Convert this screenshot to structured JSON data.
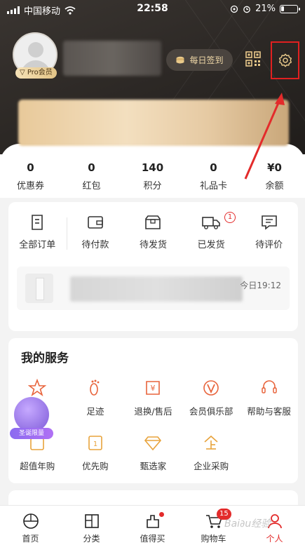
{
  "status_bar": {
    "carrier": "中国移动",
    "time": "22:58",
    "battery": "21%",
    "battery_level": 0.21
  },
  "profile": {
    "badge": "Pro会员",
    "checkin_label": "每日签到"
  },
  "assets": [
    {
      "value": "0",
      "label": "优惠券"
    },
    {
      "value": "0",
      "label": "红包"
    },
    {
      "value": "140",
      "label": "积分"
    },
    {
      "value": "0",
      "label": "礼品卡"
    },
    {
      "value": "¥0",
      "label": "余额"
    }
  ],
  "orders": {
    "items": [
      {
        "label": "全部订单",
        "icon": "order-list-icon"
      },
      {
        "label": "待付款",
        "icon": "wallet-icon"
      },
      {
        "label": "待发货",
        "icon": "box-icon"
      },
      {
        "label": "已发货",
        "icon": "truck-icon",
        "badge": "1"
      },
      {
        "label": "待评价",
        "icon": "comment-icon"
      }
    ],
    "shipment_time": "今日19:12"
  },
  "services": {
    "title": "我的服务",
    "items": [
      {
        "label": "",
        "icon": "star-icon"
      },
      {
        "label": "足迹",
        "icon": "footprint-icon"
      },
      {
        "label": "退换/售后",
        "icon": "exchange-icon"
      },
      {
        "label": "会员俱乐部",
        "icon": "vip-icon"
      },
      {
        "label": "帮助与客服",
        "icon": "headset-icon"
      },
      {
        "label": "超值年购",
        "icon": "bag-icon"
      },
      {
        "label": "优先购",
        "icon": "priority-icon"
      },
      {
        "label": "甄选家",
        "icon": "diamond-icon"
      },
      {
        "label": "企业采购",
        "icon": "enterprise-icon"
      }
    ],
    "promo_label": "圣诞限量"
  },
  "tabbar": [
    {
      "label": "首页",
      "icon": "home-icon"
    },
    {
      "label": "分类",
      "icon": "category-icon"
    },
    {
      "label": "值得买",
      "icon": "worth-buy-icon"
    },
    {
      "label": "购物车",
      "icon": "cart-icon",
      "badge": "15"
    },
    {
      "label": "个人",
      "icon": "person-icon",
      "active": true
    }
  ],
  "colors": {
    "accent": "#e32b2b",
    "header_dark": "#2b2724",
    "gold": "#e2c386"
  }
}
